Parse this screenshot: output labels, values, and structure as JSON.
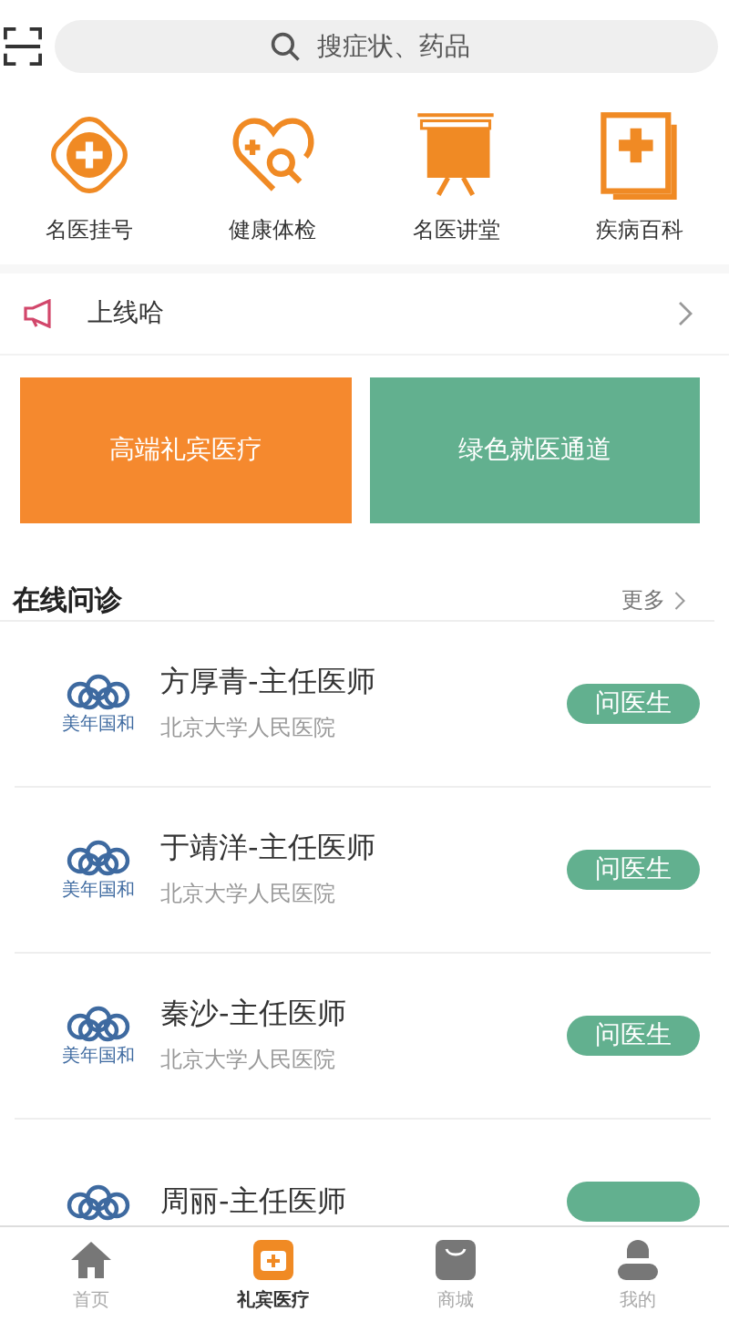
{
  "search": {
    "placeholder": "搜症状、药品"
  },
  "shortcuts": [
    {
      "kind": "registration",
      "label": "名医挂号"
    },
    {
      "kind": "checkup",
      "label": "健康体检"
    },
    {
      "kind": "lecture",
      "label": "名医讲堂"
    },
    {
      "kind": "encyclopedia",
      "label": "疾病百科"
    }
  ],
  "notice": {
    "text": "上线哈"
  },
  "banners": [
    {
      "label": "高端礼宾医疗",
      "color": "#f5892e"
    },
    {
      "label": "绿色就医通道",
      "color": "#62b08f"
    }
  ],
  "section": {
    "title": "在线问诊",
    "more": "更多"
  },
  "doctors": [
    {
      "logo_text": "美年国和",
      "name": "方厚青-主任医师",
      "hospital": "北京大学人民医院",
      "action": "问医生"
    },
    {
      "logo_text": "美年国和",
      "name": "于靖洋-主任医师",
      "hospital": "北京大学人民医院",
      "action": "问医生"
    },
    {
      "logo_text": "美年国和",
      "name": "秦沙-主任医师",
      "hospital": "北京大学人民医院",
      "action": "问医生"
    },
    {
      "name": "周丽-主任医师"
    }
  ],
  "tabbar": [
    {
      "kind": "home",
      "label": "首页",
      "selected": false
    },
    {
      "kind": "medical",
      "label": "礼宾医疗",
      "selected": true
    },
    {
      "kind": "shop",
      "label": "商城",
      "selected": false
    },
    {
      "kind": "profile",
      "label": "我的",
      "selected": false
    }
  ]
}
